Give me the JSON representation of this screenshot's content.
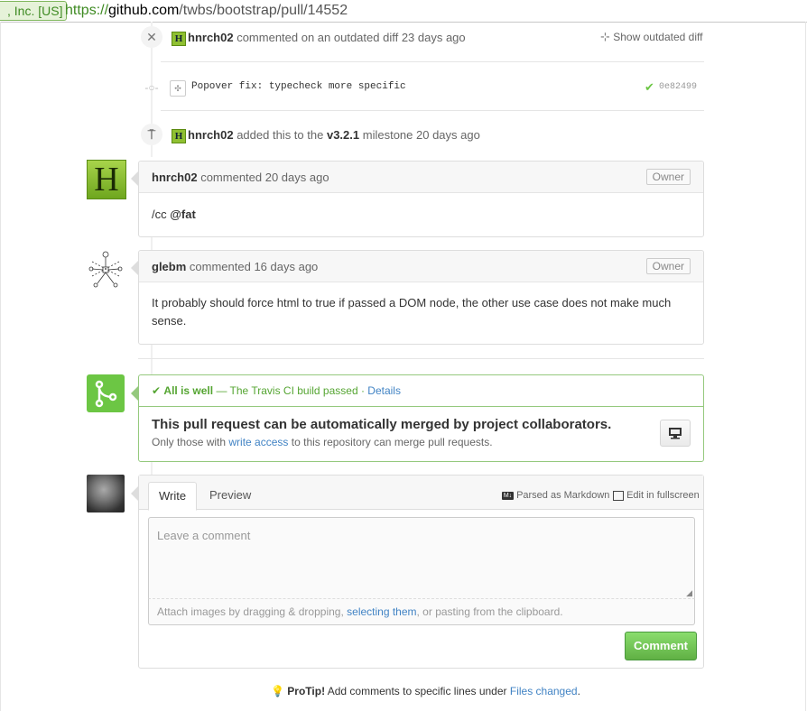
{
  "browser": {
    "ev_badge": ", Inc. [US]",
    "url_scheme": "https://",
    "url_host": "github.com",
    "url_path": "/twbs/bootstrap/pull/14552"
  },
  "timeline": {
    "outdated": {
      "user": "hnrch02",
      "text": "commented on an outdated diff 23 days ago",
      "show_label": "Show outdated diff"
    },
    "commit": {
      "message": "Popover fix: typecheck more specific",
      "sha": "0e82499"
    },
    "milestone": {
      "user": "hnrch02",
      "text_before": "added this to the",
      "milestone": "v3.2.1",
      "text_after": "milestone 20 days ago"
    }
  },
  "comments": [
    {
      "user": "hnrch02",
      "meta": "commented 20 days ago",
      "badge": "Owner",
      "body_prefix": "/cc",
      "body_mention": "@fat"
    },
    {
      "user": "glebm",
      "meta": "commented 16 days ago",
      "badge": "Owner",
      "body": "It probably should force html to true if passed a DOM node, the other use case does not make much sense."
    }
  ],
  "merge": {
    "status_strong": "All is well",
    "status_rest": "— The Travis CI build passed ·",
    "details_link": "Details",
    "title": "This pull request can be automatically merged by project collaborators.",
    "sub_before": "Only those with",
    "sub_link": "write access",
    "sub_after": "to this repository can merge pull requests."
  },
  "composer": {
    "tab_write": "Write",
    "tab_preview": "Preview",
    "markdown_label": "Parsed as Markdown",
    "fullscreen_label": "Edit in fullscreen",
    "placeholder": "Leave a comment",
    "attach_before": "Attach images by dragging & dropping,",
    "attach_link": "selecting them",
    "attach_after": ", or pasting from the clipboard.",
    "submit": "Comment"
  },
  "protip": {
    "strong": "ProTip!",
    "text": "Add comments to specific lines under",
    "link": "Files changed",
    "end": "."
  },
  "colors": {
    "accent_green": "#6cc644",
    "link_blue": "#4183c4",
    "avatar_green": "#8fc031"
  }
}
